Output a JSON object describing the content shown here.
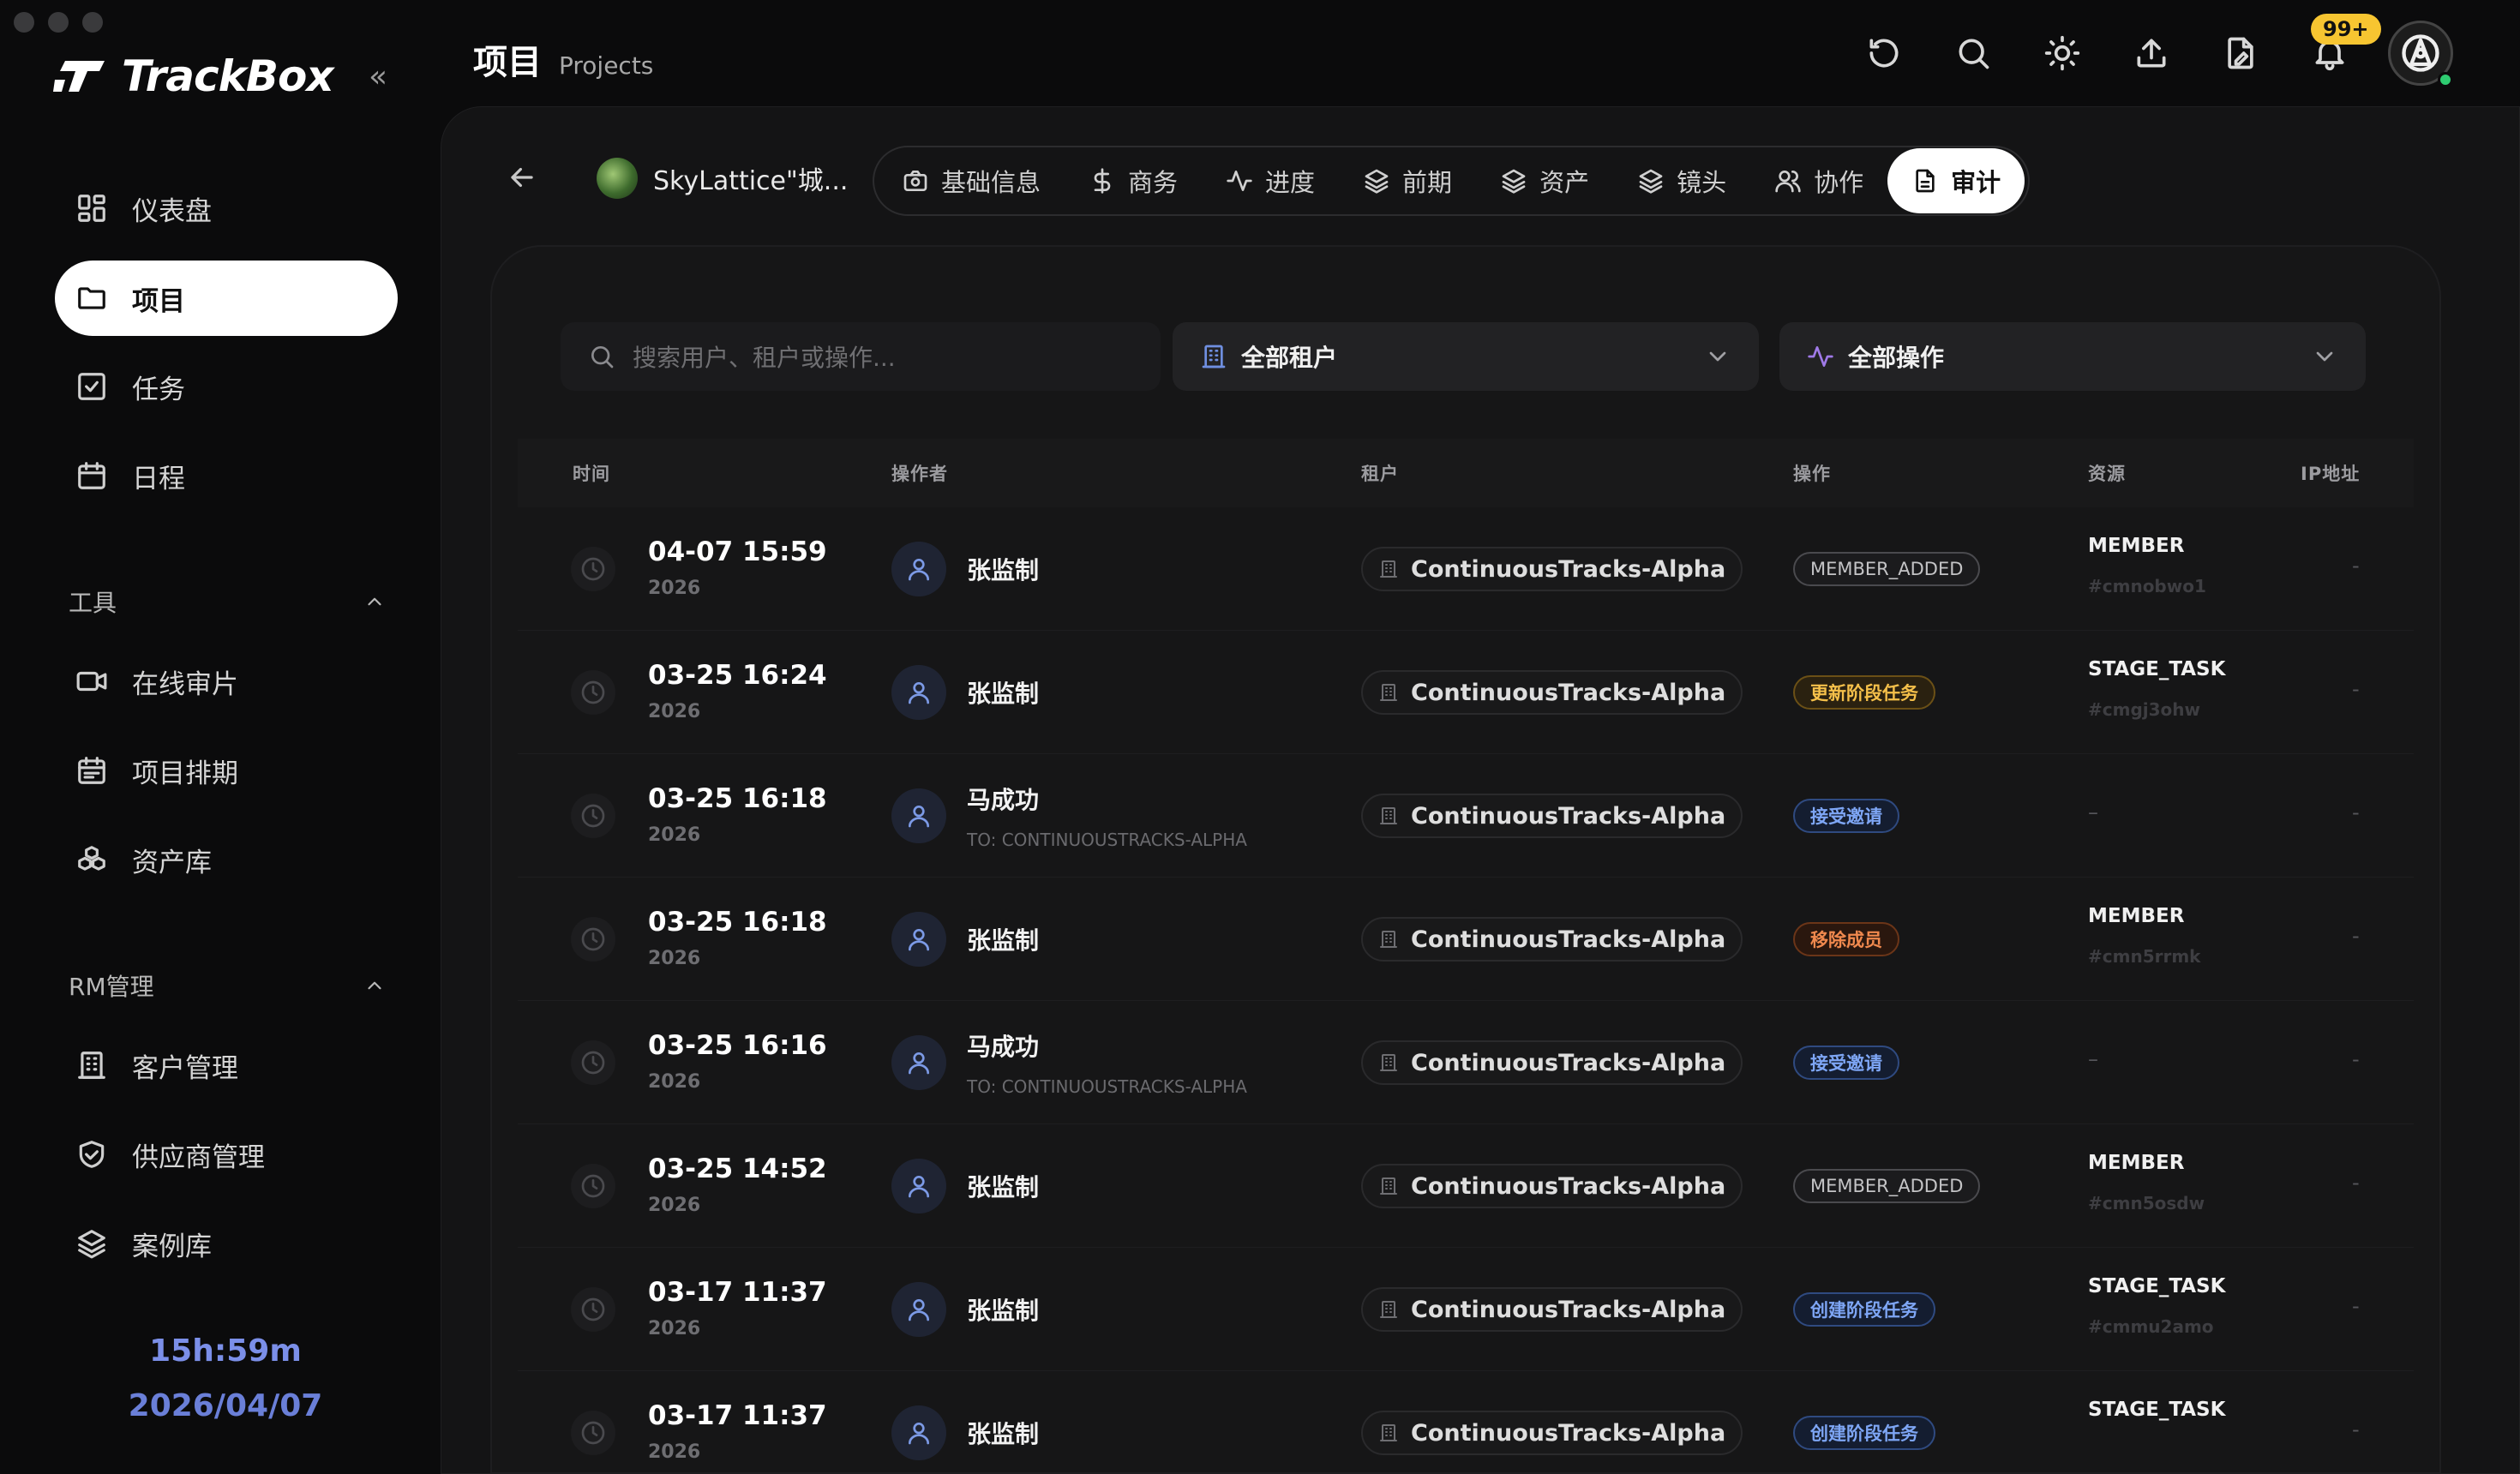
{
  "app": {
    "name": "TrackBox",
    "clock_time": "15h:59m",
    "clock_date": "2026/04/07"
  },
  "sidebar": {
    "main_items": [
      {
        "label": "仪表盘",
        "icon": "dashboard-icon"
      },
      {
        "label": "项目",
        "icon": "folder-icon",
        "active": true
      },
      {
        "label": "任务",
        "icon": "task-check-icon"
      },
      {
        "label": "日程",
        "icon": "calendar-icon"
      }
    ],
    "tools_title": "工具",
    "tools_items": [
      {
        "label": "在线审片",
        "icon": "video-camera-icon"
      },
      {
        "label": "项目排期",
        "icon": "schedule-icon"
      },
      {
        "label": "资产库",
        "icon": "assets-icon"
      }
    ],
    "rm_title": "RM管理",
    "rm_items": [
      {
        "label": "客户管理",
        "icon": "building-icon"
      },
      {
        "label": "供应商管理",
        "icon": "handshake-icon"
      },
      {
        "label": "案例库",
        "icon": "layers-icon"
      }
    ]
  },
  "header": {
    "title_zh": "项目",
    "title_en": "Projects",
    "notification_badge": "99+"
  },
  "project": {
    "name": "SkyLattice\"城..."
  },
  "tabs": [
    {
      "label": "基础信息",
      "icon": "camera-icon"
    },
    {
      "label": "商务",
      "icon": "dollar-icon"
    },
    {
      "label": "进度",
      "icon": "activity-icon"
    },
    {
      "label": "前期",
      "icon": "layers-icon"
    },
    {
      "label": "资产",
      "icon": "layers-icon"
    },
    {
      "label": "镜头",
      "icon": "layers-icon"
    },
    {
      "label": "协作",
      "icon": "users-icon"
    },
    {
      "label": "审计",
      "icon": "document-icon",
      "active": true
    }
  ],
  "filters": {
    "search_placeholder": "搜索用户、租户或操作...",
    "tenant_select": "全部租户",
    "action_select": "全部操作"
  },
  "table": {
    "headers": [
      "时间",
      "操作者",
      "租户",
      "操作",
      "资源",
      "IP地址"
    ],
    "rows": [
      {
        "time": "04-07 15:59",
        "year": "2026",
        "user": "张监制",
        "user_sub": "",
        "tenant": "ContinuousTracks-Alpha",
        "action": "MEMBER_ADDED",
        "action_style": "gray",
        "resource": "MEMBER",
        "resource_id": "#cmnobwo1",
        "ip": "-"
      },
      {
        "time": "03-25 16:24",
        "year": "2026",
        "user": "张监制",
        "user_sub": "",
        "tenant": "ContinuousTracks-Alpha",
        "action": "更新阶段任务",
        "action_style": "amber",
        "resource": "STAGE_TASK",
        "resource_id": "#cmgj3ohw",
        "ip": "-"
      },
      {
        "time": "03-25 16:18",
        "year": "2026",
        "user": "马成功",
        "user_sub": "TO: CONTINUOUSTRACKS-ALPHA",
        "tenant": "ContinuousTracks-Alpha",
        "action": "接受邀请",
        "action_style": "blue",
        "resource": "",
        "resource_id": "",
        "ip": "-"
      },
      {
        "time": "03-25 16:18",
        "year": "2026",
        "user": "张监制",
        "user_sub": "",
        "tenant": "ContinuousTracks-Alpha",
        "action": "移除成员",
        "action_style": "orange",
        "resource": "MEMBER",
        "resource_id": "#cmn5rrmk",
        "ip": "-"
      },
      {
        "time": "03-25 16:16",
        "year": "2026",
        "user": "马成功",
        "user_sub": "TO: CONTINUOUSTRACKS-ALPHA",
        "tenant": "ContinuousTracks-Alpha",
        "action": "接受邀请",
        "action_style": "blue",
        "resource": "",
        "resource_id": "",
        "ip": "-"
      },
      {
        "time": "03-25 14:52",
        "year": "2026",
        "user": "张监制",
        "user_sub": "",
        "tenant": "ContinuousTracks-Alpha",
        "action": "MEMBER_ADDED",
        "action_style": "gray",
        "resource": "MEMBER",
        "resource_id": "#cmn5osdw",
        "ip": "-"
      },
      {
        "time": "03-17 11:37",
        "year": "2026",
        "user": "张监制",
        "user_sub": "",
        "tenant": "ContinuousTracks-Alpha",
        "action": "创建阶段任务",
        "action_style": "blue",
        "resource": "STAGE_TASK",
        "resource_id": "#cmmu2amo",
        "ip": "-"
      },
      {
        "time": "03-17 11:37",
        "year": "2026",
        "user": "张监制",
        "user_sub": "",
        "tenant": "ContinuousTracks-Alpha",
        "action": "创建阶段任务",
        "action_style": "blue",
        "resource": "STAGE_TASK",
        "resource_id": "",
        "ip": "-"
      }
    ]
  }
}
